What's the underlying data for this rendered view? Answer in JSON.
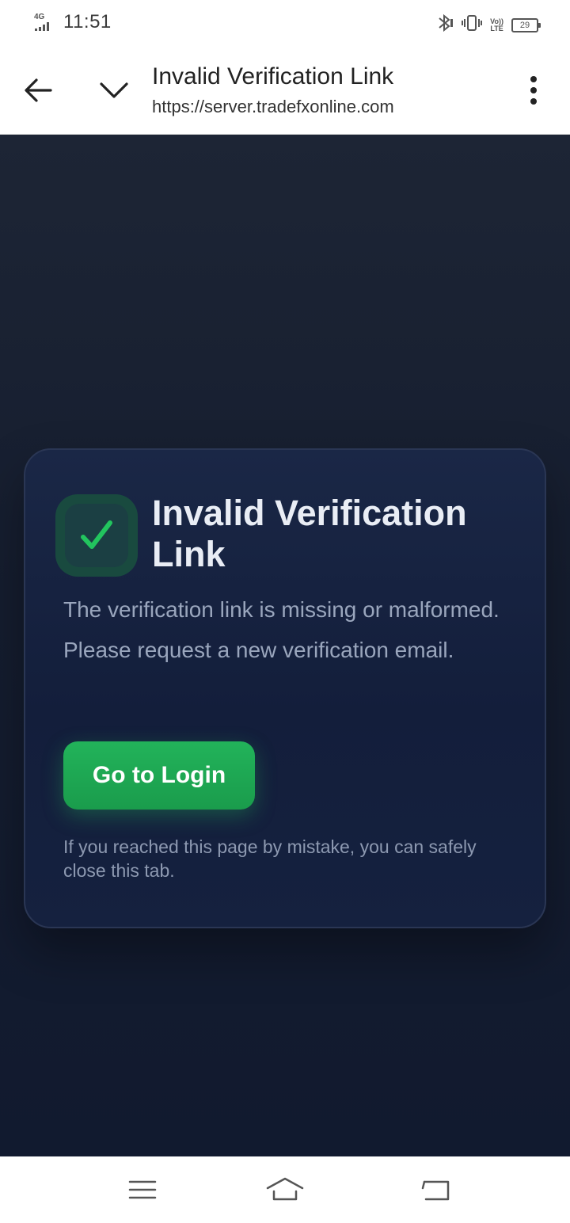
{
  "status_bar": {
    "network_type": "4G",
    "time": "11:51",
    "battery_level": "29",
    "volte_label_top": "Vo))",
    "volte_label_bottom": "LTE",
    "icons": [
      "signal-icon",
      "bluetooth-icon",
      "vibrate-icon",
      "volte-icon",
      "battery-icon"
    ]
  },
  "browser": {
    "page_title": "Invalid Verification Link",
    "url": "https://server.tradefxonline.com",
    "icons": [
      "back-arrow-icon",
      "chevron-down-icon",
      "more-vertical-icon"
    ]
  },
  "card": {
    "badge_glyph": "✓",
    "title": "Invalid Verification Link",
    "description": "The verification link is missing or malformed. Please request a new verification email.",
    "button_label": "Go to Login",
    "note": "If you reached this page by mistake, you can safely close this tab."
  },
  "colors": {
    "background_top": "#1d2535",
    "background_bottom": "#111a2f",
    "card": "#15213f",
    "accent_green": "#22b35a",
    "badge_bg": "#194a3f",
    "check_color": "#22c55e"
  },
  "nav_bar": {
    "icons": [
      "menu-icon",
      "home-icon",
      "back-icon"
    ]
  }
}
